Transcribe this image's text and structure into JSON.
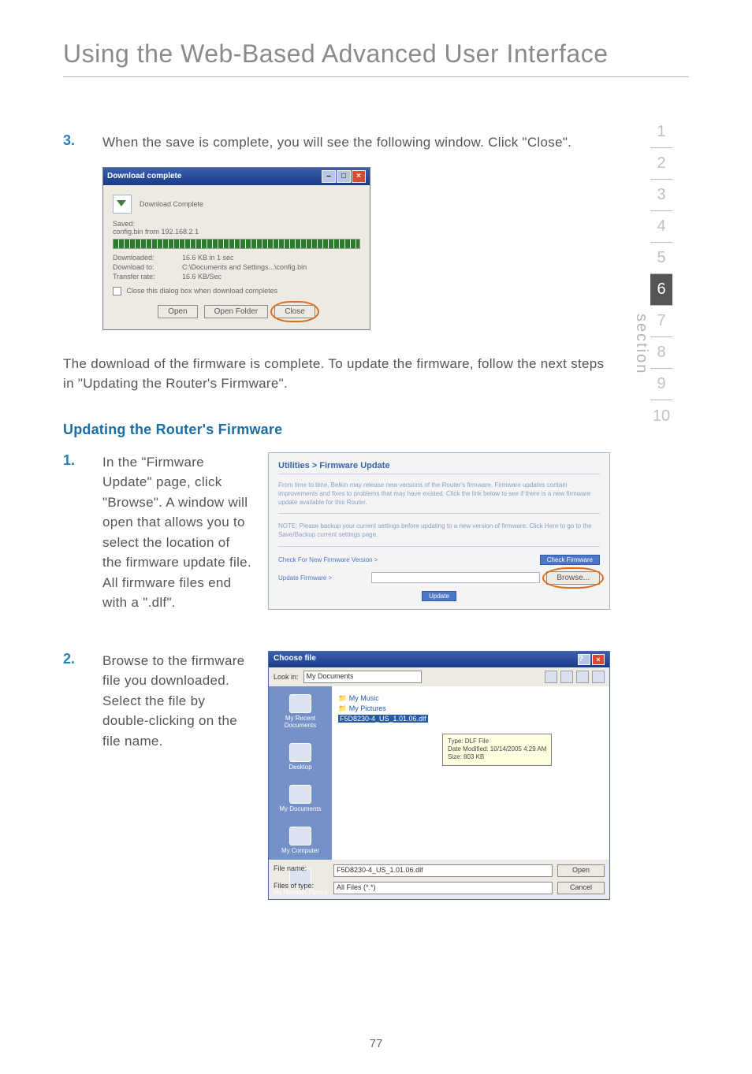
{
  "title": "Using the Web-Based Advanced User Interface",
  "step3": {
    "num": "3.",
    "text": "When the save is complete, you will see the following window. Click \"Close\"."
  },
  "shot1": {
    "title": "Download complete",
    "subtitle": "Download Complete",
    "saved_label": "Saved:",
    "saved_value": "config.bin from 192.168.2.1",
    "downloaded_k": "Downloaded:",
    "downloaded_v": "16.6 KB in 1 sec",
    "downloadto_k": "Download to:",
    "downloadto_v": "C:\\Documents and Settings...\\config.bin",
    "transfer_k": "Transfer rate:",
    "transfer_v": "16.6 KB/Sec",
    "checkbox": "Close this dialog box when download completes",
    "btn_open": "Open",
    "btn_folder": "Open Folder",
    "btn_close": "Close"
  },
  "para_after_shot1": "The download of the firmware is complete. To update the firmware, follow the next steps in \"Updating the Router's Firmware\".",
  "subhead": "Updating the Router's Firmware",
  "step_u1": {
    "num": "1.",
    "text": "In the \"Firmware Update\" page, click \"Browse\". A window will open that allows you to select the location of the firmware update file. All firmware files end with a \".dlf\"."
  },
  "shot2": {
    "hdr": "Utilities > Firmware Update",
    "p1": "From time to time, Belkin may release new versions of the Router's firmware. Firmware updates contain improvements and fixes to problems that may have existed. Click the link below to see if there is a new firmware update available for this Router.",
    "p2": "NOTE: Please backup your current settings before updating to a new version of firmware. Click Here to go to the Save/Backup current settings page.",
    "row1_label": "Check For New Firmware Version >",
    "row1_btn": "Check Firmware",
    "row2_label": "Update Firmware >",
    "row2_btn": "Browse...",
    "update_btn": "Update"
  },
  "step_u2": {
    "num": "2.",
    "text": "Browse to the firmware file you downloaded. Select the file by double-clicking on the file name."
  },
  "shot3": {
    "title": "Choose file",
    "lookin_label": "Look in:",
    "lookin_value": "My Documents",
    "folders": [
      "My Music",
      "My Pictures"
    ],
    "selected": "F5D8230-4_US_1.01.06.dlf",
    "tooltip_l1": "Type: DLF File",
    "tooltip_l2": "Date Modified: 10/14/2005 4:29 AM",
    "tooltip_l3": "Size: 803 KB",
    "places": [
      "My Recent Documents",
      "Desktop",
      "My Documents",
      "My Computer",
      "My Network Places"
    ],
    "filename_k": "File name:",
    "filename_v": "F5D8230-4_US_1.01.06.dlf",
    "filetype_k": "Files of type:",
    "filetype_v": "All Files (*.*)",
    "btn_open": "Open",
    "btn_cancel": "Cancel"
  },
  "nav": {
    "items": [
      "1",
      "2",
      "3",
      "4",
      "5",
      "6",
      "7",
      "8",
      "9",
      "10"
    ],
    "active_index": 5,
    "label": "section"
  },
  "page_number": "77"
}
